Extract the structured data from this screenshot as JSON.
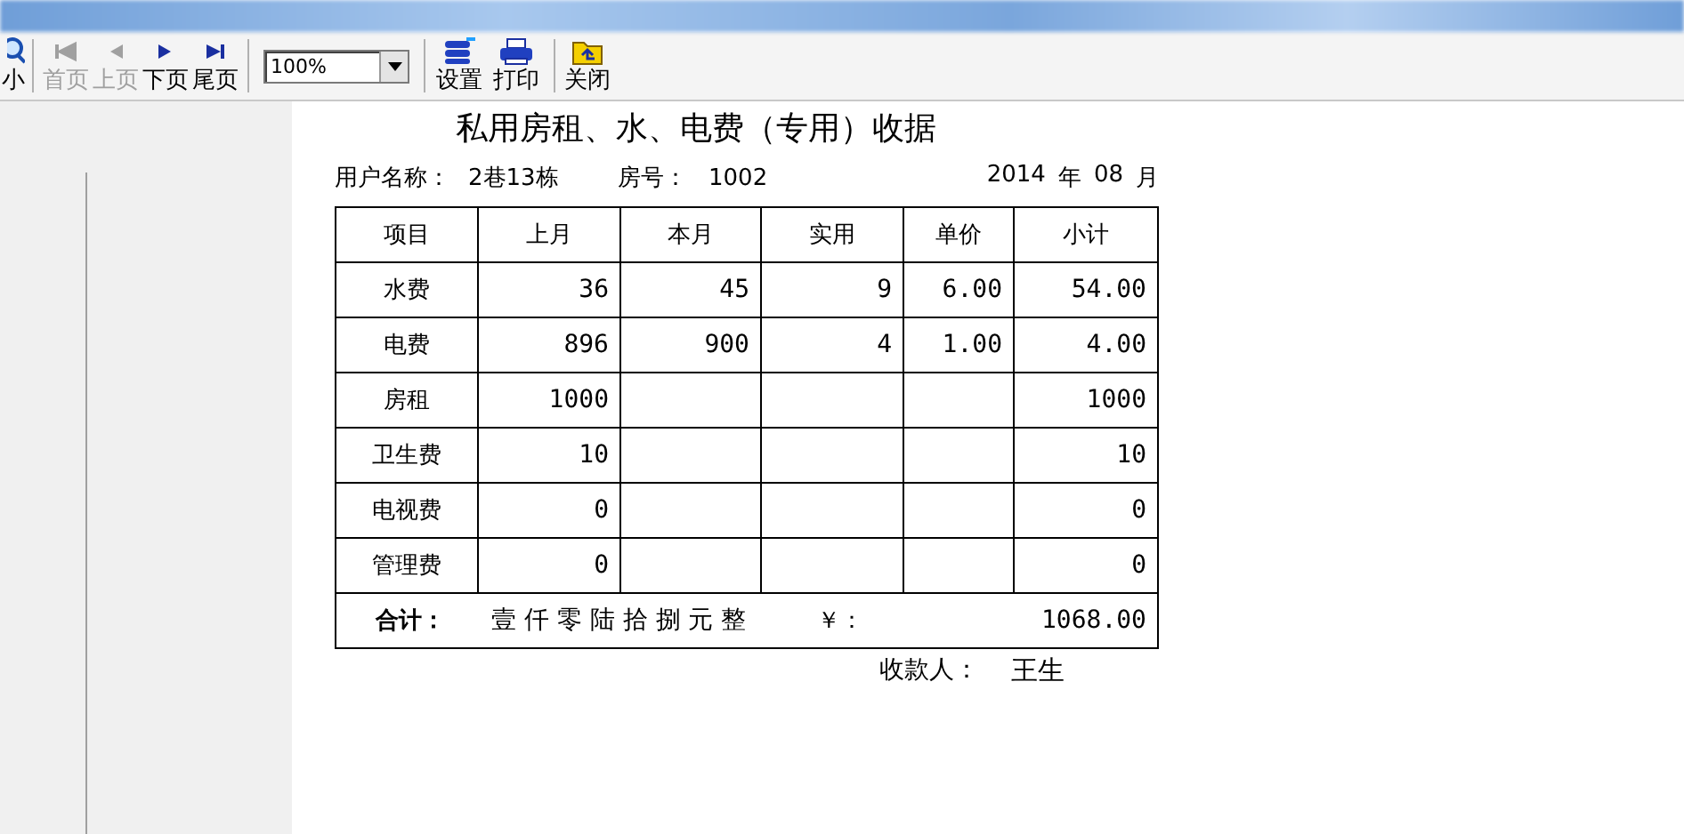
{
  "toolbar": {
    "items": [
      {
        "kind": "shrink",
        "label": "小",
        "disabled": false
      },
      {
        "kind": "separator"
      },
      {
        "kind": "first",
        "label": "首页",
        "disabled": true
      },
      {
        "kind": "prev",
        "label": "上页",
        "disabled": true
      },
      {
        "kind": "next",
        "label": "下页",
        "disabled": false
      },
      {
        "kind": "last",
        "label": "尾页",
        "disabled": false
      },
      {
        "kind": "separator"
      },
      {
        "kind": "zoom",
        "value": "100%"
      },
      {
        "kind": "separator"
      },
      {
        "kind": "setup",
        "label": "设置",
        "disabled": false
      },
      {
        "kind": "print",
        "label": "打印",
        "disabled": false
      },
      {
        "kind": "separator"
      },
      {
        "kind": "close",
        "label": "关闭",
        "disabled": false
      }
    ]
  },
  "receipt": {
    "title": "私用房租、水、电费（专用）收据",
    "user_label": "用户名称：",
    "user_value": "2巷13栋",
    "room_label": "房号：",
    "room_value": "1002",
    "year": "2014",
    "year_unit": "年",
    "month": "08",
    "month_unit": "月",
    "columns": [
      "项目",
      "上月",
      "本月",
      "实用",
      "单价",
      "小计"
    ],
    "rows": [
      [
        "水费",
        "36",
        "45",
        "9",
        "6.00",
        "54.00"
      ],
      [
        "电费",
        "896",
        "900",
        "4",
        "1.00",
        "4.00"
      ],
      [
        "房租",
        "1000",
        null,
        null,
        null,
        "1000"
      ],
      [
        "卫生费",
        "10",
        null,
        null,
        null,
        "10"
      ],
      [
        "电视费",
        "0",
        null,
        null,
        null,
        "0"
      ],
      [
        "管理费",
        "0",
        null,
        null,
        null,
        "0"
      ]
    ],
    "total": {
      "label": "合计：",
      "words": "壹 仟 零 陆 拾 捌 元 整",
      "currency": "￥：",
      "amount": "1068.00"
    },
    "payee_label": "收款人：",
    "payee": "王生"
  }
}
